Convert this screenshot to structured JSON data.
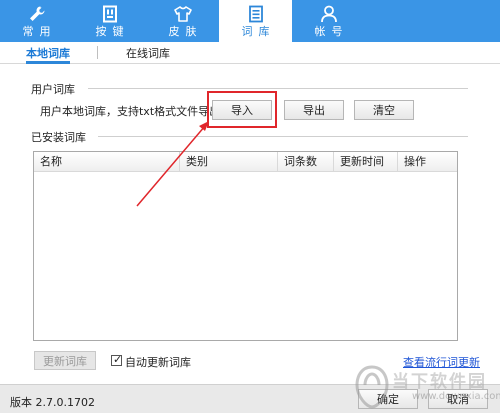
{
  "tabs": [
    {
      "label": "常用",
      "icon": "wrench-icon",
      "active": false
    },
    {
      "label": "按键",
      "icon": "keyboard-icon",
      "active": false
    },
    {
      "label": "皮肤",
      "icon": "shirt-icon",
      "active": false
    },
    {
      "label": "词库",
      "icon": "document-icon",
      "active": true
    },
    {
      "label": "帐号",
      "icon": "user-icon",
      "active": false
    }
  ],
  "subtabs": {
    "local": "本地词库",
    "online": "在线词库"
  },
  "user_lexicon": {
    "group_label": "用户词库",
    "description": "用户本地词库，支持txt格式文件导出",
    "import_label": "导入",
    "export_label": "导出",
    "clear_label": "清空"
  },
  "installed": {
    "group_label": "已安装词库",
    "columns": [
      "名称",
      "类别",
      "词条数",
      "更新时间",
      "操作"
    ],
    "rows": []
  },
  "bottom": {
    "update_label": "更新词库",
    "auto_update_label": "自动更新词库",
    "auto_update_checked": true,
    "popular_link": "查看流行词更新"
  },
  "footer": {
    "version": "版本 2.7.0.1702",
    "ok_label": "确定",
    "cancel_label": "取消"
  },
  "watermark": {
    "text": "当下软件园",
    "url": "www.downxia.com"
  },
  "colors": {
    "accent": "#3a95e6",
    "highlight": "#e0262b",
    "link": "#1f55d6"
  }
}
